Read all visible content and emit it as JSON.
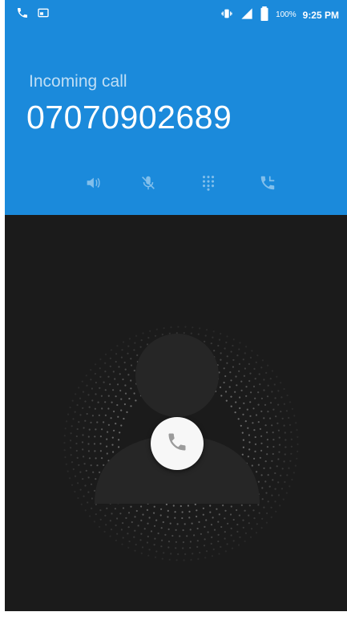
{
  "status_bar": {
    "time": "9:25 PM",
    "battery_percent": "100%",
    "icons": [
      "phone-icon",
      "screenshot-icon",
      "vibrate-icon",
      "signal-icon",
      "battery-icon"
    ]
  },
  "call": {
    "status": "Incoming call",
    "number": "07070902689"
  },
  "actions": [
    {
      "icon": "speaker-icon"
    },
    {
      "icon": "mute-icon"
    },
    {
      "icon": "dialpad-icon"
    },
    {
      "icon": "add-call-icon"
    }
  ],
  "answer": {
    "icon": "phone-answer-icon"
  },
  "colors": {
    "header": "#1b8adb",
    "background": "#1b1b1b",
    "answer_button": "#f7f7f7",
    "dots": "#8a8a8a"
  }
}
